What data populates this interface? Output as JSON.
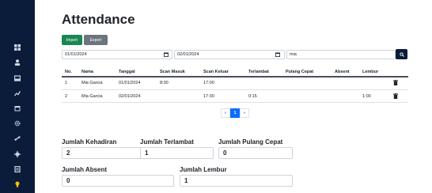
{
  "page": {
    "title": "Attendance"
  },
  "actions": {
    "import_label": "Import",
    "export_label": "Export"
  },
  "filters": {
    "start_date": "01/01/2024",
    "end_date": "02/01/2024",
    "search_value": "mia"
  },
  "sidebar": {
    "icons": [
      "grid-icon",
      "user-icon",
      "inbox-icon",
      "chart-icon",
      "calendar-icon",
      "gear-icon",
      "link-icon",
      "settings-icon",
      "document-icon",
      "lightbulb-icon"
    ]
  },
  "table": {
    "headers": [
      "No.",
      "Nama",
      "Tanggal",
      "Scan Masuk",
      "Scan Keluar",
      "Terlambat",
      "Pulang Cepat",
      "Absent",
      "Lembur"
    ],
    "rows": [
      {
        "no": "1",
        "nama": "Mia Garcia",
        "tanggal": "01/01/2024",
        "scan_masuk": "8:00",
        "scan_keluar": "17:00",
        "terlambat": "",
        "pulang_cepat": "",
        "absent": "",
        "lembur": ""
      },
      {
        "no": "2",
        "nama": "Mia Garcia",
        "tanggal": "02/01/2024",
        "scan_masuk": "",
        "scan_keluar": "17:30",
        "terlambat": "0:15",
        "pulang_cepat": "",
        "absent": "",
        "lembur": "1:00"
      }
    ]
  },
  "pagination": {
    "prev": "«",
    "current": "1",
    "next": "»"
  },
  "summary": {
    "kehadiran_label": "Jumlah Kehadiran",
    "kehadiran_value": "2",
    "terlambat_label": "Jumlah Terlambat",
    "terlambat_value": "1",
    "pulang_cepat_label": "Jumlah Pulang Cepat",
    "pulang_cepat_value": "0",
    "absent_label": "Jumlah Absent",
    "absent_value": "0",
    "lembur_label": "Jumlah Lembur",
    "lembur_value": "1"
  },
  "colors": {
    "sidebar": "#0b1c3a",
    "import": "#198754",
    "export": "#6c757d",
    "page_active": "#0d6efd"
  }
}
